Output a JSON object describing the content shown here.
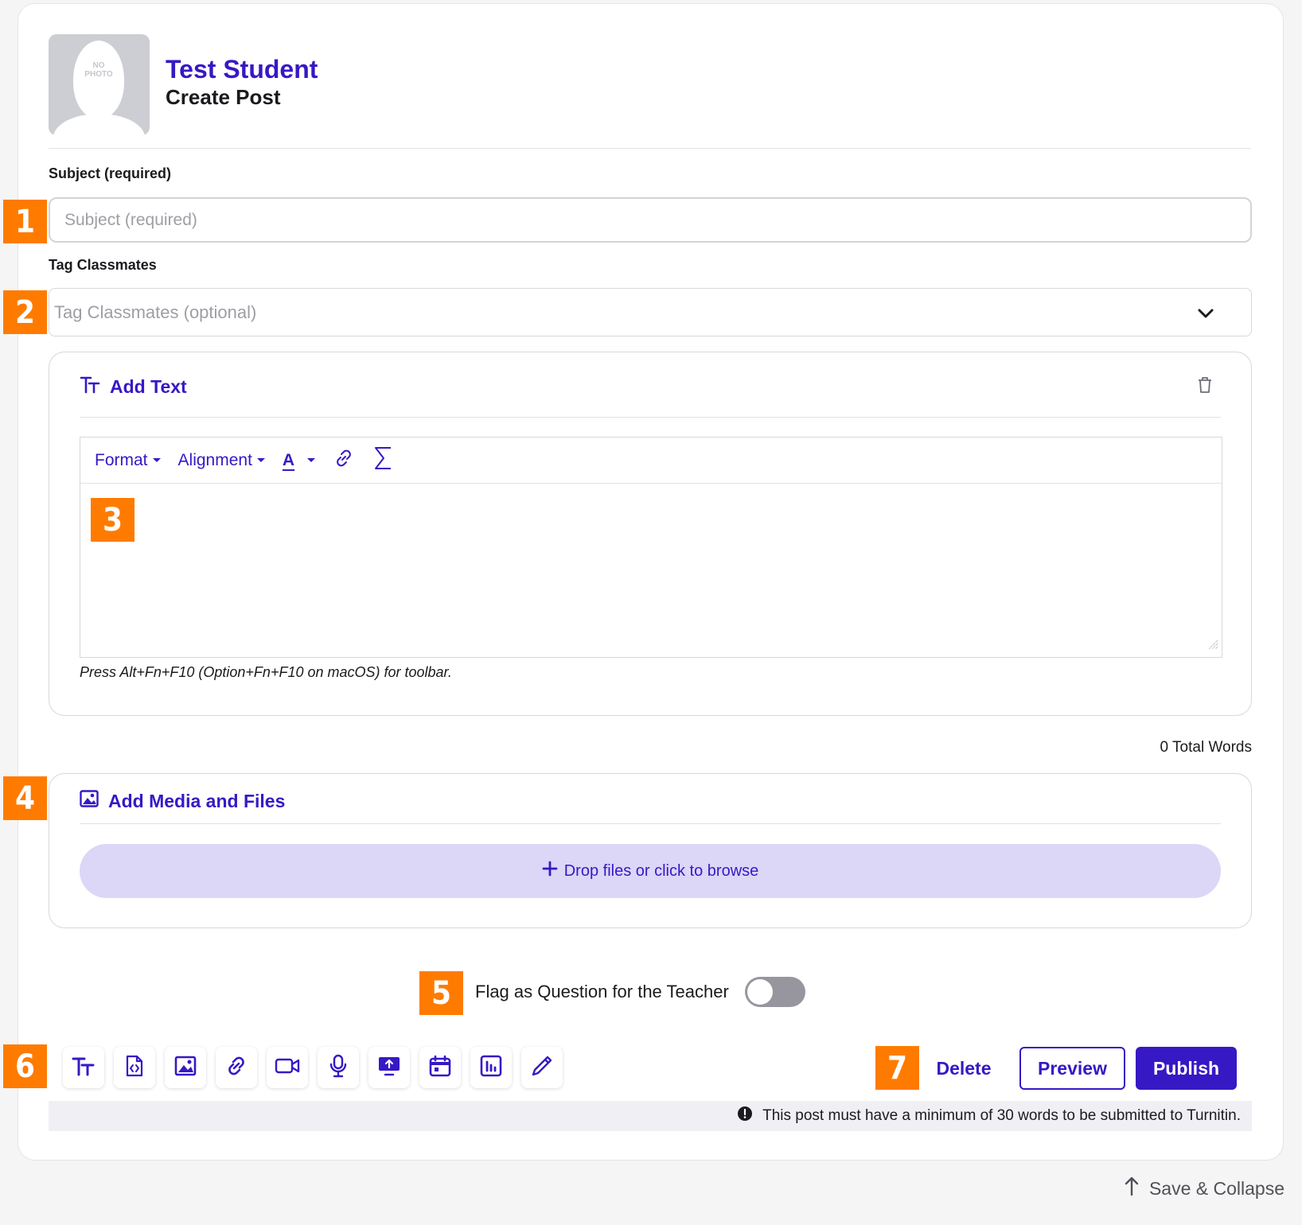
{
  "header": {
    "avatar_text_line1": "NO",
    "avatar_text_line2": "PHOTO",
    "student_name": "Test Student",
    "page_title": "Create Post"
  },
  "subject": {
    "label": "Subject (required)",
    "placeholder": "Subject (required)",
    "value": ""
  },
  "tag_classmates": {
    "label": "Tag Classmates",
    "placeholder": "Tag Classmates (optional)"
  },
  "text_block": {
    "title": "Add Text",
    "toolbar": {
      "format": "Format",
      "alignment": "Alignment",
      "text_color_letter": "A"
    },
    "hint": "Press Alt+Fn+F10 (Option+Fn+F10 on macOS) for toolbar."
  },
  "word_count": "0 Total Words",
  "media_block": {
    "title": "Add Media and Files",
    "dropzone_label": "Drop files or click to browse"
  },
  "flag": {
    "label": "Flag as Question for the Teacher",
    "enabled": false
  },
  "tools": [
    "text-icon",
    "embed-code-icon",
    "image-icon",
    "link-icon",
    "video-icon",
    "microphone-icon",
    "screen-upload-icon",
    "calendar-icon",
    "poll-chart-icon",
    "pencil-icon"
  ],
  "actions": {
    "delete": "Delete",
    "preview": "Preview",
    "publish": "Publish"
  },
  "notice": "This post must have a minimum of 30 words to be submitted to Turnitin.",
  "save_collapse": "Save & Collapse",
  "annotations": [
    "1",
    "2",
    "3",
    "4",
    "5",
    "6",
    "7"
  ],
  "colors": {
    "accent": "#3718c5",
    "badge": "#ff7b00",
    "dropzone": "#dcd6f7"
  }
}
